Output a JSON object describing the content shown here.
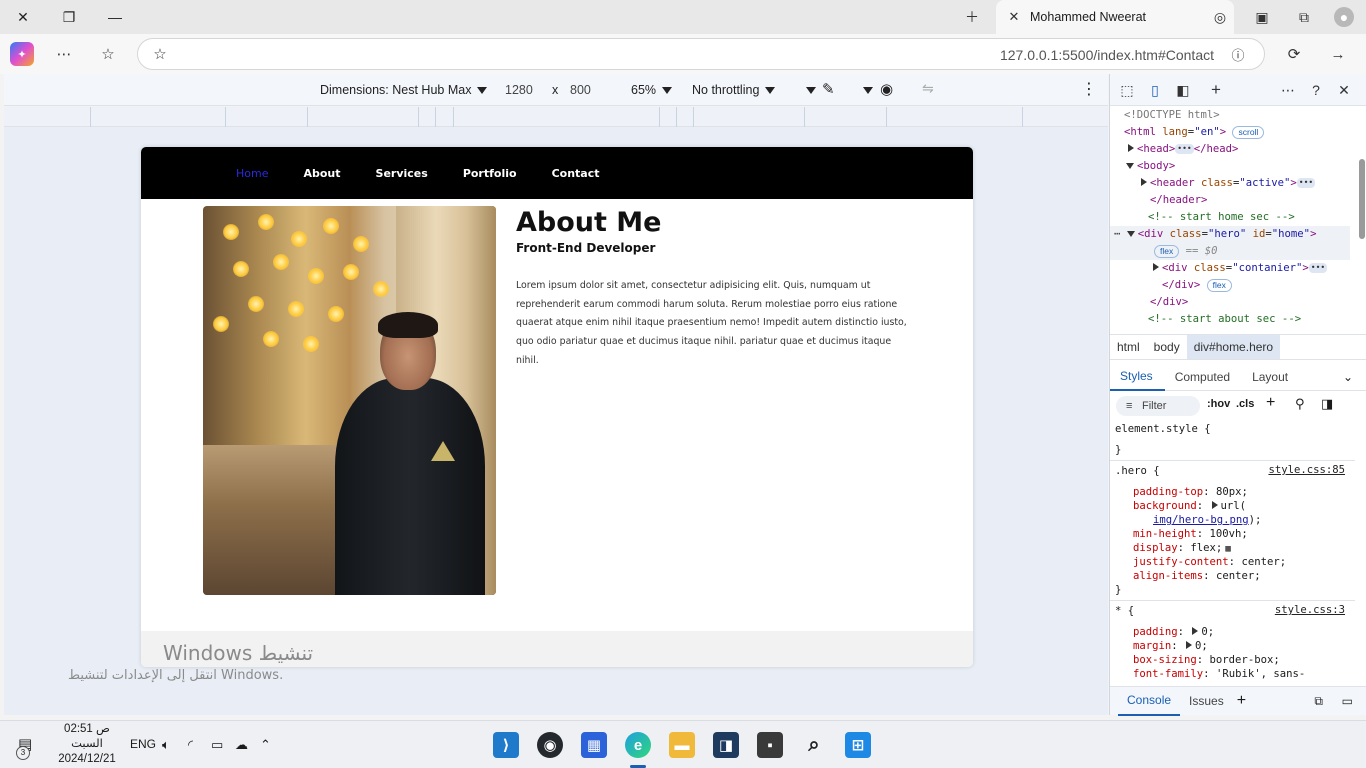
{
  "browser": {
    "tab_title": "Mohammed Nweerat",
    "url": "127.0.0.1:5500/index.htm#Contact"
  },
  "device_toolbar": {
    "dimensions_label": "Dimensions: Nest Hub Max",
    "width": "1280",
    "times": "x",
    "height": "800",
    "zoom": "65%",
    "throttling": "No throttling"
  },
  "site": {
    "nav": [
      "Home",
      "About",
      "Services",
      "Portfolio",
      "Contact"
    ],
    "about_title": "About Me",
    "about_subtitle": "Front-End Developer",
    "about_text": "Lorem ipsum dolor sit amet, consectetur adipisicing elit. Quis, numquam ut reprehenderit earum commodi harum soluta. Rerum molestiae porro eius ratione quaerat atque enim nihil itaque praesentium nemo! Impedit autem distinctio iusto, quo odio pariatur quae et ducimus itaque nihil. pariatur quae et ducimus itaque nihil."
  },
  "windows_activation": {
    "title": "Windows تنشيط",
    "subtitle": "انتقل إلى الإعدادات لتنشيط Windows."
  },
  "devtools": {
    "dom": {
      "doctype": "<!DOCTYPE html>",
      "html_open": "<html",
      "html_attr": "lang",
      "html_val": "\"en\"",
      "html_close": ">",
      "scroll_pill": "scroll",
      "head_open": "<head>",
      "head_close": "</head>",
      "body_open": "<body>",
      "header_open": "<header",
      "header_attr": "class",
      "header_val": "\"active\"",
      "header_close": "</header>",
      "comment_home": "<!-- start home sec -->",
      "div_hero_open": "<div",
      "div_hero_attr1": "class",
      "div_hero_val1": "\"hero\"",
      "div_hero_attr2": "id",
      "div_hero_val2": "\"home\"",
      "flex_pill": "flex",
      "eq_dollar": "== $0",
      "div_cont_open": "<div",
      "div_cont_attr": "class",
      "div_cont_val": "\"contanier\"",
      "div_close": "</div>",
      "comment_about": "<!-- start about sec -->",
      "ellipsis": "•••"
    },
    "breadcrumbs": [
      "html",
      "body",
      "div#home.hero"
    ],
    "style_tabs": [
      "Styles",
      "Computed",
      "Layout"
    ],
    "filter": "Filter",
    "hov": ":hov",
    "cls": ".cls",
    "rules": {
      "element_style": "element.style {",
      "close_brace": "}",
      "hero_selector": ".hero {",
      "hero_source": "style.css:85",
      "hero_props": [
        {
          "name": "padding-top",
          "value": "80px;"
        },
        {
          "name": "background",
          "value": "url("
        },
        {
          "name": "",
          "value": "img/hero-bg.png"
        },
        {
          "name": "",
          "value": ");"
        },
        {
          "name": "min-height",
          "value": "100vh;"
        },
        {
          "name": "display",
          "value": "flex;"
        },
        {
          "name": "justify-content",
          "value": "center;"
        },
        {
          "name": "align-items",
          "value": "center;"
        }
      ],
      "star_selector": "* {",
      "star_source": "style.css:3",
      "star_props": [
        {
          "name": "padding",
          "value": "0;"
        },
        {
          "name": "margin",
          "value": "0;"
        },
        {
          "name": "box-sizing",
          "value": "border-box;"
        },
        {
          "name": "font-family",
          "value": "'Rubik', sans-"
        }
      ]
    },
    "console_tabs": [
      "Console",
      "Issues"
    ]
  },
  "taskbar": {
    "time": "02:51 ص",
    "day": "السبت",
    "date": "2024/12/21",
    "lang": "ENG",
    "notif_count": "3"
  }
}
